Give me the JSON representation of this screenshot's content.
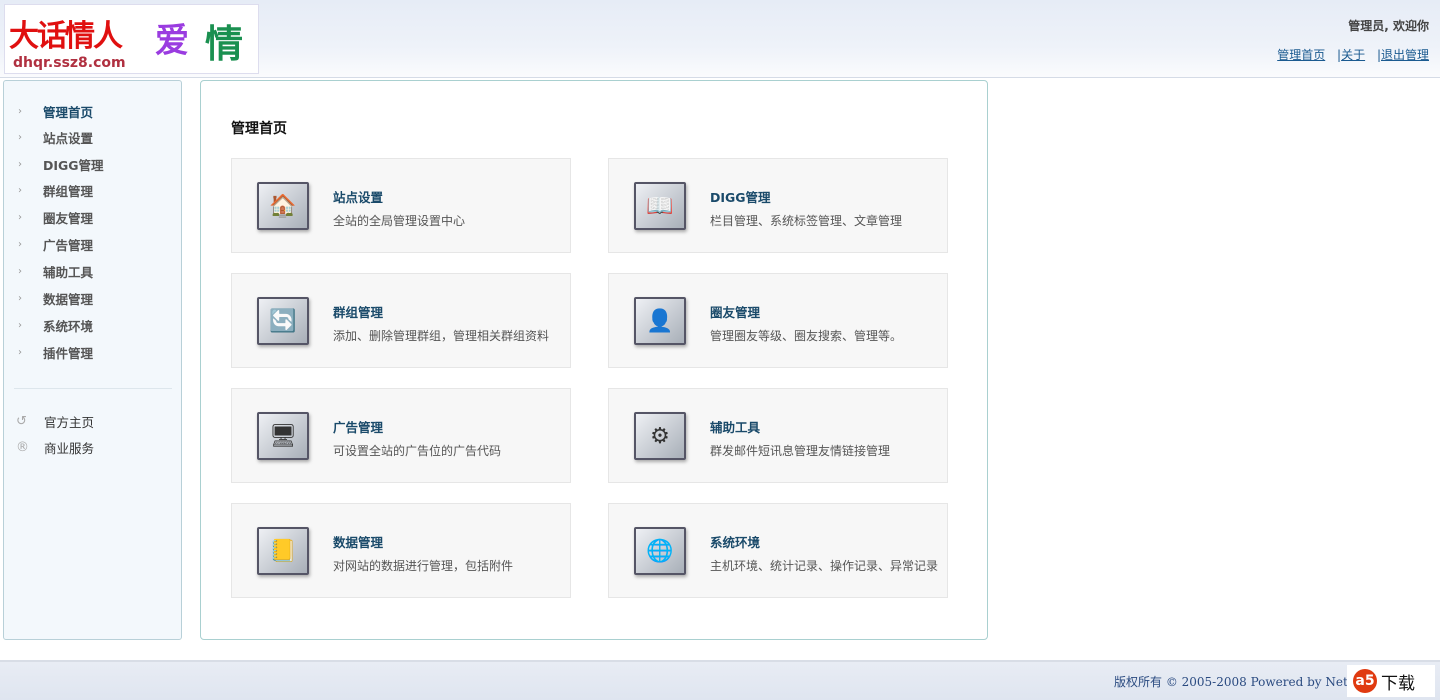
{
  "header": {
    "logo": {
      "title": "大话情人",
      "love": "爱",
      "qing": "情",
      "url": "dhqr.ssz8.com"
    },
    "welcome": "管理员, 欢迎你",
    "links": [
      "管理首页",
      "关于",
      "退出管理"
    ]
  },
  "sidebar": {
    "items": [
      {
        "label": "管理首页"
      },
      {
        "label": "站点设置"
      },
      {
        "label": "DIGG管理"
      },
      {
        "label": "群组管理"
      },
      {
        "label": "圈友管理"
      },
      {
        "label": "广告管理"
      },
      {
        "label": "辅助工具"
      },
      {
        "label": "数据管理"
      },
      {
        "label": "系统环境"
      },
      {
        "label": "插件管理"
      }
    ],
    "external": [
      {
        "label": "官方主页",
        "icon": "check-circle-icon"
      },
      {
        "label": "商业服务",
        "icon": "registered-icon"
      }
    ]
  },
  "main": {
    "title": "管理首页",
    "cards": [
      {
        "title": "站点设置",
        "desc": "全站的全局管理设置中心",
        "icon": "🏠"
      },
      {
        "title": "DIGG管理",
        "desc": "栏目管理、系统标签管理、文章管理",
        "icon": "📖"
      },
      {
        "title": "群组管理",
        "desc": "添加、删除管理群组，管理相关群组资料",
        "icon": "🔄"
      },
      {
        "title": "圈友管理",
        "desc": "管理圈友等级、圈友搜索、管理等。",
        "icon": "👤"
      },
      {
        "title": "广告管理",
        "desc": "可设置全站的广告位的广告代码",
        "icon": "🖥"
      },
      {
        "title": "辅助工具",
        "desc": "群发邮件短讯息管理友情链接管理",
        "icon": "⚙"
      },
      {
        "title": "数据管理",
        "desc": "对网站的数据进行管理，包括附件",
        "icon": "📒"
      },
      {
        "title": "系统环境",
        "desc": "主机环境、统计记录、操作记录、异常记录",
        "icon": "🌐"
      }
    ]
  },
  "footer": {
    "copyright": "版权所有  © 2005-2008 Powered by Netv",
    "badge_a": "a5",
    "badge_text": "下载"
  }
}
